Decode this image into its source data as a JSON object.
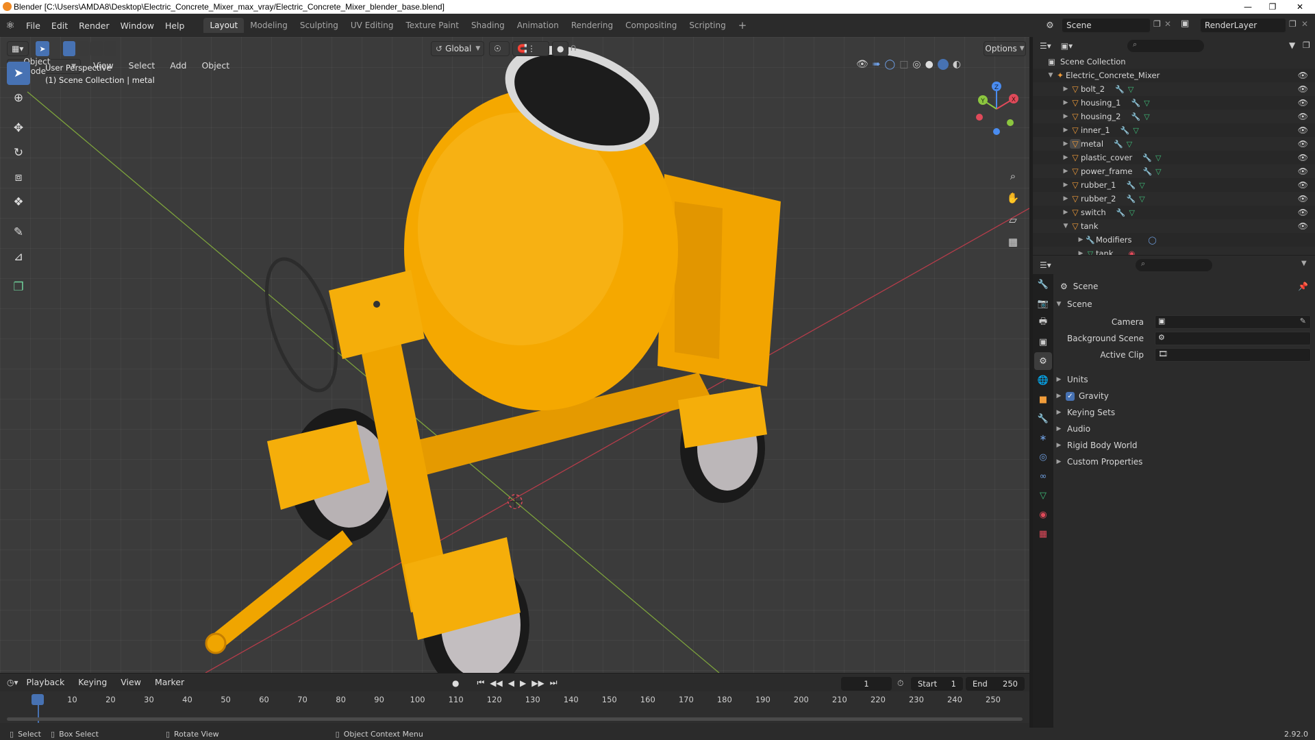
{
  "window": {
    "title": "Blender [C:\\Users\\AMDA8\\Desktop\\Electric_Concrete_Mixer_max_vray/Electric_Concrete_Mixer_blender_base.blend]"
  },
  "menu": [
    "File",
    "Edit",
    "Render",
    "Window",
    "Help"
  ],
  "workspaces": [
    "Layout",
    "Modeling",
    "Sculpting",
    "UV Editing",
    "Texture Paint",
    "Shading",
    "Animation",
    "Rendering",
    "Compositing",
    "Scripting"
  ],
  "active_workspace": "Layout",
  "scene_name": "Scene",
  "render_layer": "RenderLayer",
  "viewport": {
    "mode": "Object Mode",
    "header_menus": [
      "View",
      "Select",
      "Add",
      "Object"
    ],
    "orientation": "Global",
    "options_label": "Options",
    "overlay_line1": "User Perspective",
    "overlay_line2": "(1) Scene Collection | metal",
    "gizmo_axes": [
      "X",
      "Y",
      "Z"
    ]
  },
  "outliner": {
    "root": "Scene Collection",
    "collection": "Electric_Concrete_Mixer",
    "objects": [
      "bolt_2",
      "housing_1",
      "housing_2",
      "inner_1",
      "metal",
      "plastic_cover",
      "power_frame",
      "rubber_1",
      "rubber_2",
      "switch",
      "tank"
    ],
    "tank_children": [
      "Modifiers",
      "tank"
    ]
  },
  "properties": {
    "context": "Scene",
    "panel": "Scene",
    "fields": [
      {
        "label": "Camera",
        "value": ""
      },
      {
        "label": "Background Scene",
        "value": ""
      },
      {
        "label": "Active Clip",
        "value": ""
      }
    ],
    "subpanels": [
      "Units",
      "Gravity",
      "Keying Sets",
      "Audio",
      "Rigid Body World",
      "Custom Properties"
    ],
    "gravity_checked": true
  },
  "timeline": {
    "menus": [
      "Playback",
      "Keying",
      "View",
      "Marker"
    ],
    "current_frame": "1",
    "start_label": "Start",
    "start": "1",
    "end_label": "End",
    "end": "250",
    "ticks": [
      "1",
      "10",
      "20",
      "30",
      "40",
      "50",
      "60",
      "70",
      "80",
      "90",
      "100",
      "110",
      "120",
      "130",
      "140",
      "150",
      "160",
      "170",
      "180",
      "190",
      "200",
      "210",
      "220",
      "230",
      "240",
      "250"
    ]
  },
  "statusbar": {
    "select": "Select",
    "box_select": "Box Select",
    "rotate_view": "Rotate View",
    "context_menu": "Object Context Menu",
    "version": "2.92.0"
  },
  "colors": {
    "accent": "#4772b3",
    "mixer_yellow": "#f5a800",
    "x_axis": "#e04a5a",
    "y_axis": "#8cc63f",
    "z_axis": "#4a8cf0"
  }
}
